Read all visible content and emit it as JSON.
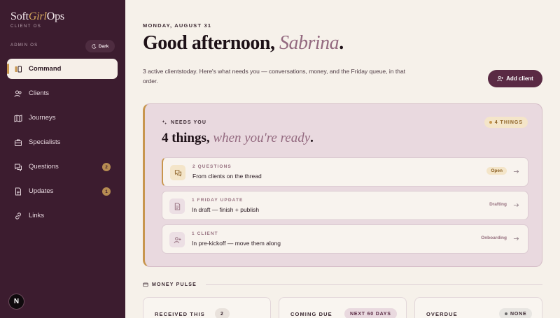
{
  "sidebar": {
    "brand": {
      "part1": "Soft",
      "part2": "Girl",
      "part3": "Ops"
    },
    "brand_sub": "CLIENT OS",
    "admin_label": "ADMIN OS",
    "theme_toggle": "Dark",
    "items": [
      {
        "label": "Command",
        "icon": "command-icon",
        "active": true
      },
      {
        "label": "Clients",
        "icon": "users-icon"
      },
      {
        "label": "Journeys",
        "icon": "map-icon"
      },
      {
        "label": "Specialists",
        "icon": "briefcase-icon"
      },
      {
        "label": "Questions",
        "icon": "chat-icon",
        "badge": "2"
      },
      {
        "label": "Updates",
        "icon": "document-icon",
        "badge": "1"
      },
      {
        "label": "Links",
        "icon": "link-icon"
      }
    ],
    "avatar": "N"
  },
  "header": {
    "date": "MONDAY, AUGUST 31",
    "greeting": "Good afternoon, ",
    "name": "Sabrina",
    "period": ".",
    "summary": "3 active clientstoday. Here's what needs you — conversations, money, and the Friday queue, in that order.",
    "add_client": "Add client"
  },
  "needs": {
    "label": "NEEDS YOU",
    "count": "4 THINGS",
    "title_main": "4 things,",
    "title_soft": "when you're ready",
    "title_end": ".",
    "tasks": [
      {
        "kicker": "2 QUESTIONS",
        "text": "From clients on the thread",
        "status": "Open",
        "icon": "chat-bubbles-icon"
      },
      {
        "kicker": "1 FRIDAY UPDATE",
        "text": "In draft — finish + publish",
        "status": "Drafting",
        "icon": "document-icon"
      },
      {
        "kicker": "1 CLIENT",
        "text": "In pre-kickoff — move them along",
        "status": "Onboarding",
        "icon": "user-plus-icon"
      }
    ]
  },
  "money": {
    "label": "MONEY PULSE",
    "cards": [
      {
        "label": "RECEIVED THIS",
        "pill": "2"
      },
      {
        "label": "COMING DUE",
        "pill": "NEXT 60 DAYS"
      },
      {
        "label": "OVERDUE",
        "pill": "NONE"
      }
    ]
  },
  "colors": {
    "sidebar": "#3c1c2f",
    "accent_gold": "#c8964e",
    "accent_plum": "#5a2a44",
    "needs_bg": "#e9d9df"
  }
}
